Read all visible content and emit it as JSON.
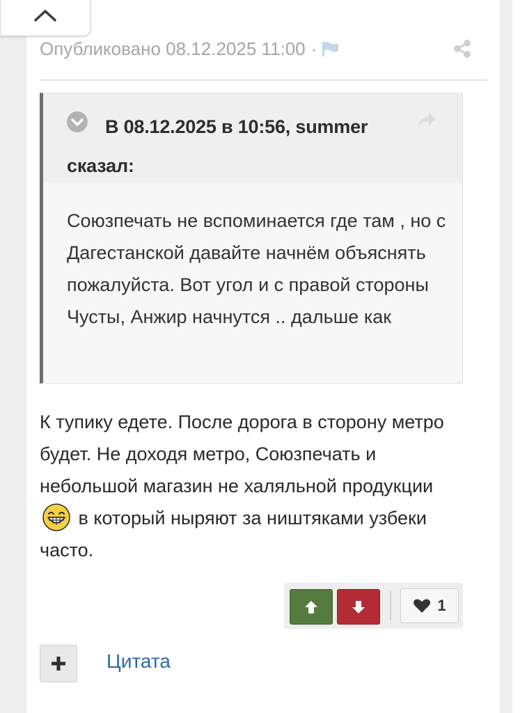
{
  "meta": {
    "published_text": "Опубликовано 08.12.2025 11:00",
    "separator": "·"
  },
  "quote": {
    "header": "В 08.12.2025 в 10:56, summer сказал:",
    "body": "Союзпечать не вспоминается где там , но с Дагестанской давайте начнём объяснять пожалуйста. Вот угол и с правой стороны Чусты, Анжир начнутся .. дальше как"
  },
  "post": {
    "text_before_emoji": "К тупику едете. После дорога в сторону метро будет. Не доходя метро, Союзпечать и небольшой магазин не халяльной продукции",
    "emoji": "grinning-face-emoji",
    "text_after_emoji": "в который ныряют за ништяками узбеки часто."
  },
  "reputation": {
    "upvote_icon": "arrow-up-icon",
    "downvote_icon": "arrow-down-icon",
    "like_icon": "heart-icon",
    "like_count": "1",
    "up_color": "#557c3e",
    "down_color": "#b32b34"
  },
  "actions": {
    "multiquote_icon": "plus-icon",
    "quote_link": "Цитата"
  },
  "colors": {
    "link": "#2f6aa6",
    "meta_text": "#a6a6a6",
    "quote_border": "#6e6e6e"
  }
}
